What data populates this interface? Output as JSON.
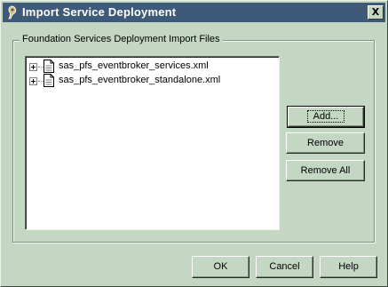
{
  "window": {
    "title": "Import Service Deployment",
    "close_label": "X",
    "app_icon": "sas-app-icon"
  },
  "group": {
    "legend": "Foundation Services Deployment Import Files"
  },
  "tree": {
    "items": [
      {
        "label": "sas_pfs_eventbroker_services.xml",
        "expander": "plus-icon",
        "icon": "document-icon"
      },
      {
        "label": "sas_pfs_eventbroker_standalone.xml",
        "expander": "plus-icon",
        "icon": "document-icon"
      }
    ]
  },
  "side_buttons": {
    "add": "Add...",
    "remove": "Remove",
    "remove_all": "Remove All"
  },
  "footer_buttons": {
    "ok": "OK",
    "cancel": "Cancel",
    "help": "Help"
  },
  "colors": {
    "dialog_bg": "#c3d7c3",
    "titlebar_bg": "#3f5a78",
    "titlebar_text": "#ffffff",
    "list_bg": "#ffffff"
  }
}
